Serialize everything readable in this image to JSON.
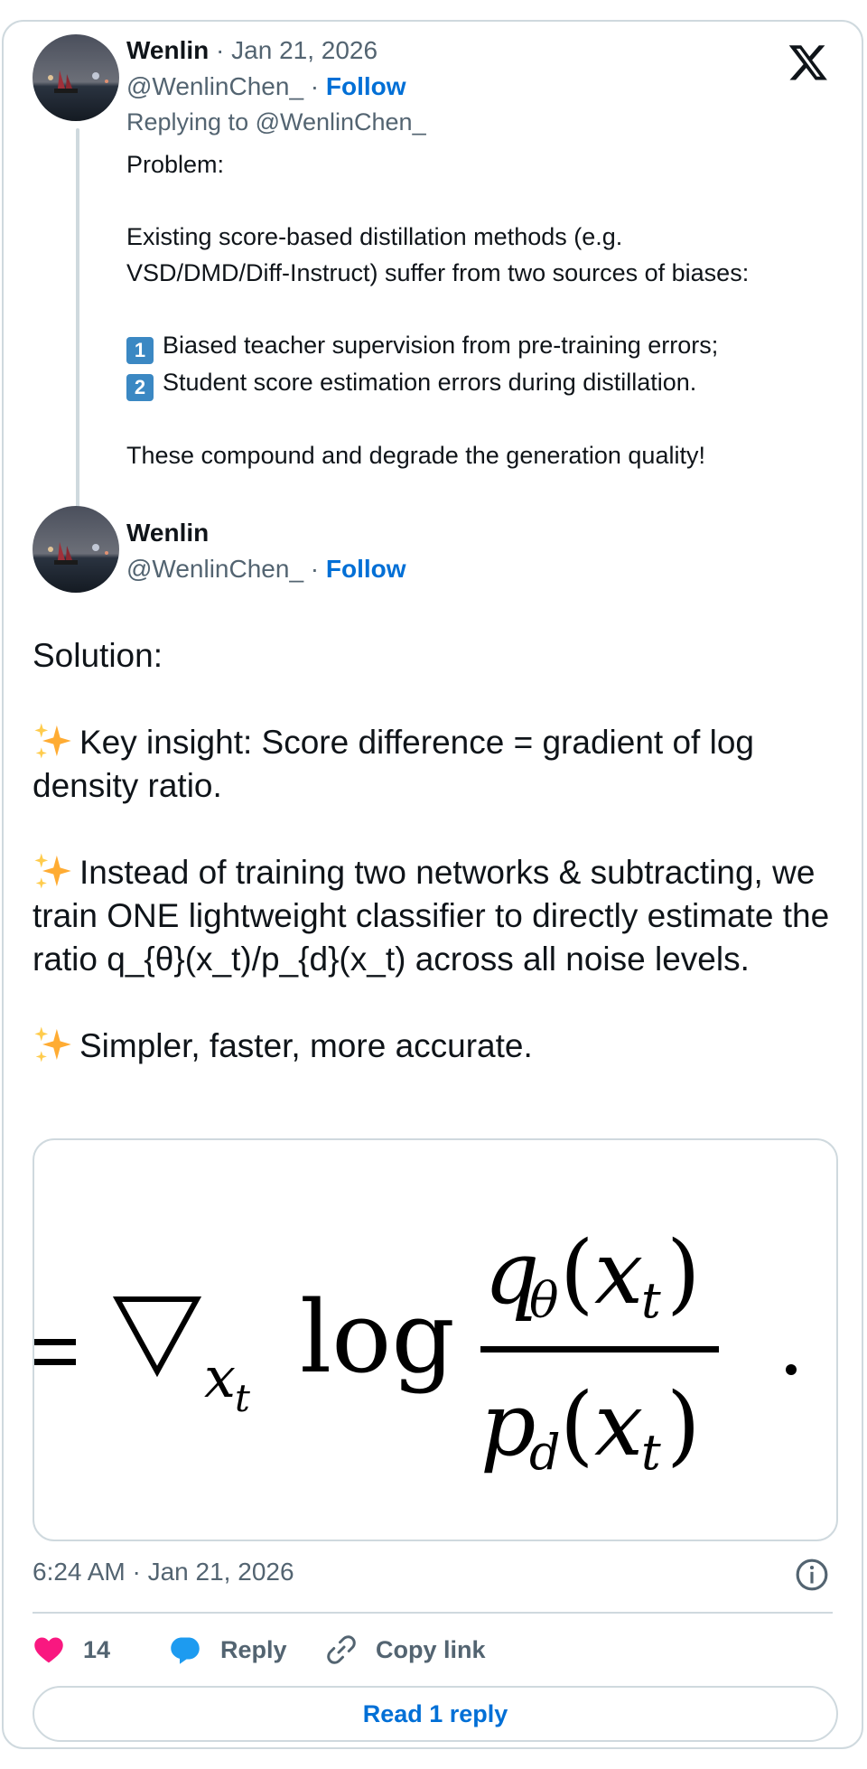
{
  "reply_tweet": {
    "author_name": "Wenlin",
    "separator": " · ",
    "date": "Jan 21, 2026",
    "handle": "@WenlinChen_",
    "follow_label": "Follow",
    "replying_to": "Replying to @WenlinChen_",
    "paragraphs": [
      "Problem:",
      "",
      "Existing score-based distillation methods (e.g.",
      "VSD/DMD/Diff-Instruct) suffer from two sources of biases:",
      ""
    ],
    "list_items": [
      {
        "badge": "1",
        "text": "Biased teacher supervision from pre-training errors;"
      },
      {
        "badge": "2",
        "text": "Student score estimation errors during distillation."
      }
    ],
    "closing": "These compound and degrade the generation quality!"
  },
  "main_tweet": {
    "author_name": "Wenlin",
    "handle": "@WenlinChen_",
    "follow_label": "Follow",
    "intro": "Solution:",
    "points": [
      "Key insight: Score difference = gradient of log density ratio.",
      "Instead of training two networks & subtracting, we train ONE lightweight classifier to directly estimate the ratio q_{θ}(x_t)/p_{d}(x_t) across all noise levels.",
      "Simpler, faster, more accurate."
    ],
    "timestamp": "6:24 AM · Jan 21, 2026",
    "likes_count": "14",
    "reply_label": "Reply",
    "copy_link_label": "Copy link",
    "read_replies_label": "Read 1 reply"
  },
  "colors": {
    "accent": "#006fd6",
    "like": "#f91880",
    "reply": "#1d9bf0",
    "muted": "#536471",
    "border": "#cfd9de"
  },
  "icons": [
    "x-logo-icon",
    "info-icon",
    "heart-icon",
    "speech-bubble-icon",
    "link-icon",
    "sparkles-icon",
    "keycap-one-icon",
    "keycap-two-icon"
  ]
}
